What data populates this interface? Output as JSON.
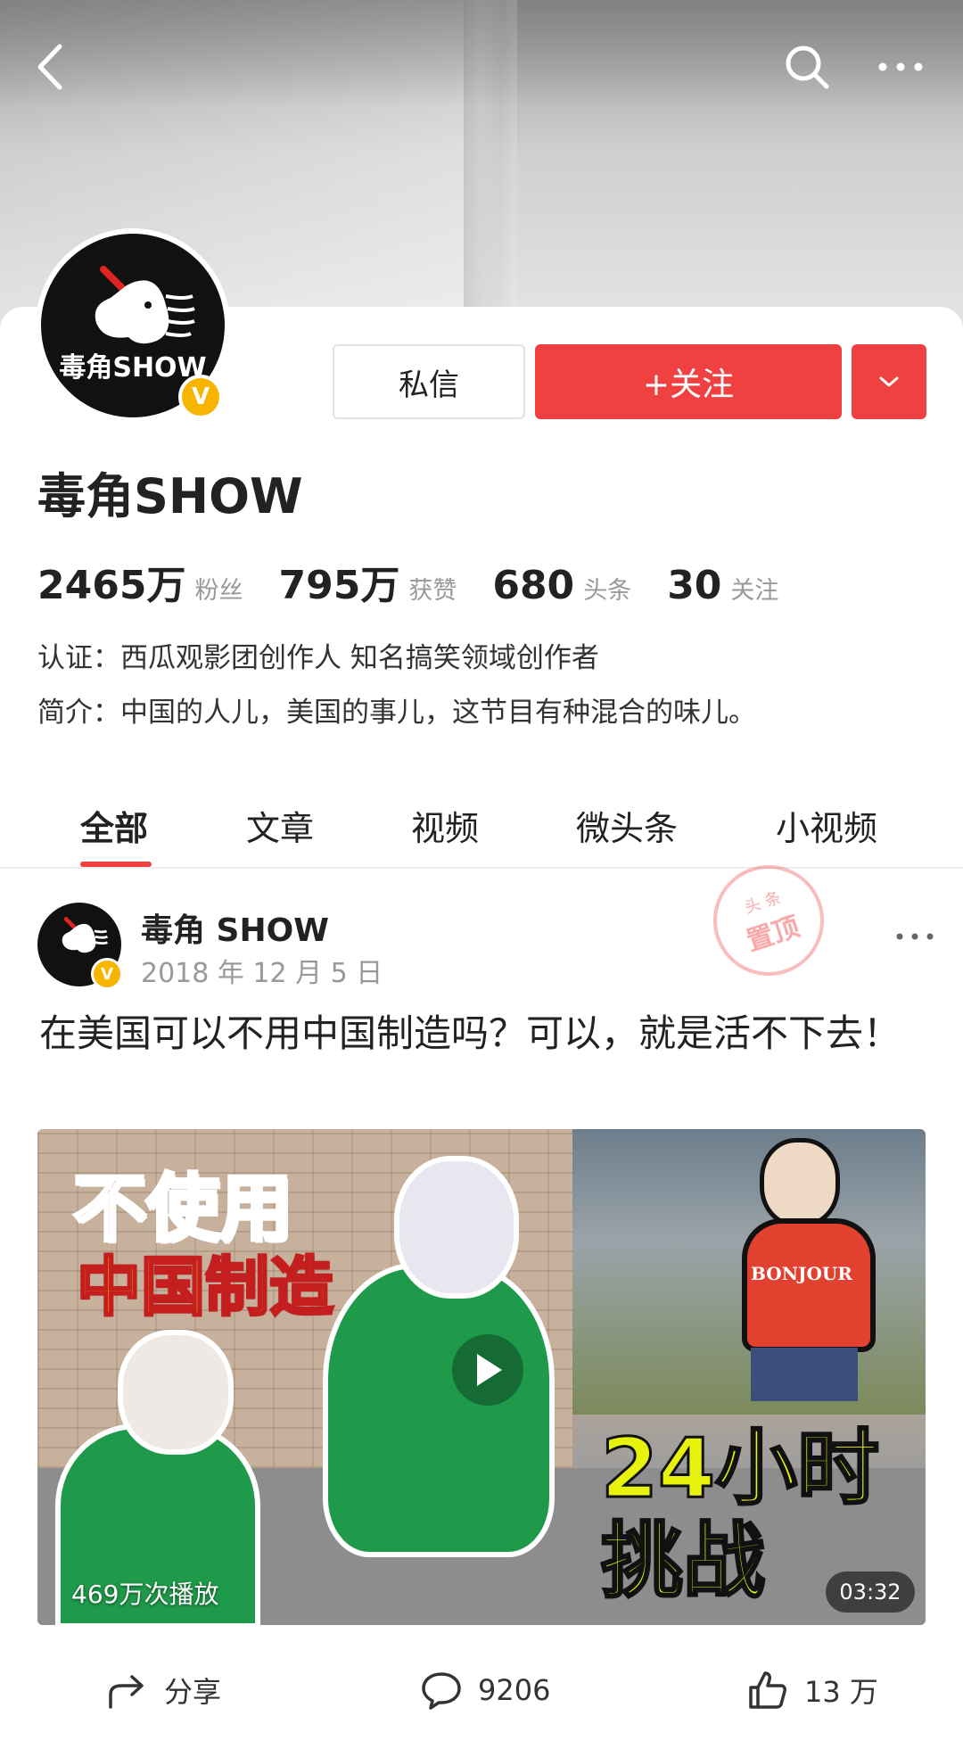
{
  "header": {
    "back_icon": "chevron-left-icon",
    "search_icon": "search-icon",
    "more_icon": "more-horizontal-icon"
  },
  "profile": {
    "name": "毒角SHOW",
    "avatar_text": "毒角SHOW",
    "verified_badge": "V",
    "buttons": {
      "message": "私信",
      "follow": "+关注",
      "dropdown_icon": "chevron-down-icon"
    },
    "stats": [
      {
        "value": "2465万",
        "label": "粉丝"
      },
      {
        "value": "795万",
        "label": "获赞"
      },
      {
        "value": "680",
        "label": "头条"
      },
      {
        "value": "30",
        "label": "关注"
      }
    ],
    "verification": "认证：西瓜观影团创作人 知名搞笑领域创作者",
    "bio": "简介：中国的人儿，美国的事儿，这节目有种混合的味儿。"
  },
  "tabs": [
    {
      "label": "全部",
      "active": true
    },
    {
      "label": "文章",
      "active": false
    },
    {
      "label": "视频",
      "active": false
    },
    {
      "label": "微头条",
      "active": false
    },
    {
      "label": "小视频",
      "active": false
    }
  ],
  "post": {
    "author": "毒角 SHOW",
    "date": "2018 年 12 月 5 日",
    "pin_stamp": {
      "top": "头 条",
      "main": "置顶"
    },
    "title": "在美国可以不用中国制造吗？可以，就是活不下去！",
    "video": {
      "overlay_red": "不使用",
      "overlay_yellow": "中国制造",
      "overlay_24": "24小时",
      "overlay_challenge": "挑战",
      "shirt_text": "BONJOUR",
      "play_count": "469万次播放",
      "duration": "03:32"
    },
    "actions": {
      "share": "分享",
      "comments": "9206",
      "likes": "13 万"
    }
  },
  "colors": {
    "accent": "#f04142",
    "verified": "#f7b500"
  }
}
